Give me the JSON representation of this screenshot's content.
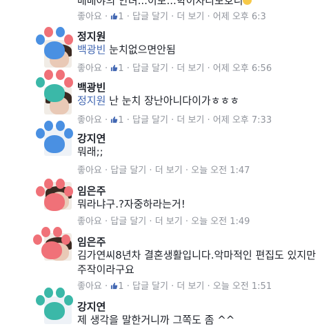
{
  "top_partial": {
    "text": "배배야의 안녀...이보...학이자리보호니",
    "meta": {
      "like": "좋아요",
      "count": "1",
      "reply": "답글 달기",
      "more": "더 보기",
      "time": "어제 오후 6:3"
    }
  },
  "comments": [
    {
      "name": "정지원",
      "mention": "백광빈",
      "text": " 눈치없으면안됨",
      "meta": {
        "like": "좋아요",
        "count": "1",
        "reply": "답글 달기",
        "more": "더 보기",
        "time": "어제 오후 6:56"
      },
      "paw_color": "#4a90e2",
      "paw_accent": "#f07178"
    },
    {
      "name": "백광빈",
      "mention": "정지원",
      "text": " 난 눈치 장난아니다이가ㅎㅎㅎ",
      "meta": {
        "like": "좋아요",
        "count": "1",
        "reply": "답글 달기",
        "more": "더 보기",
        "time": "어제 오후 7:33"
      },
      "paw_color": "#3bb8a8",
      "paw_accent": "#f07178"
    },
    {
      "name": "강지연",
      "text": "뭐래;;",
      "meta": {
        "like": "좋아요",
        "reply": "답글 달기",
        "more": "더 보기",
        "time": "오늘 오전 1:47"
      },
      "paw_color": "#4a90e2"
    },
    {
      "name": "임은주",
      "text": "뭐라냐구.?자중하라는거!",
      "meta": {
        "like": "좋아요",
        "reply": "답글 달기",
        "more": "더 보기",
        "time": "오늘 오전 1:49"
      },
      "paw_color": "#f07178"
    },
    {
      "name": "임은주",
      "text_lines": [
        "김가연씨8년차 결혼생활입니다.악마적인 편집도 있지만",
        "주작이라구요"
      ],
      "meta": {
        "like": "좋아요",
        "count": "1",
        "reply": "답글 달기",
        "more": "더 보기",
        "time": "오늘 오전 1:51"
      },
      "paw_color": "#f07178"
    },
    {
      "name": "강지연",
      "text": "제 생각을 말한거니까 그쪽도 좀 ^^",
      "paw_color": "#3bb8a8"
    }
  ],
  "colors": {
    "name": "#1d2129",
    "meta": "#90949c",
    "mention": "#4267b2",
    "like_icon": "#4267b2"
  },
  "icons": {
    "like": "thumbs-up-icon",
    "avatar_overlay": "paw-print-icon"
  }
}
